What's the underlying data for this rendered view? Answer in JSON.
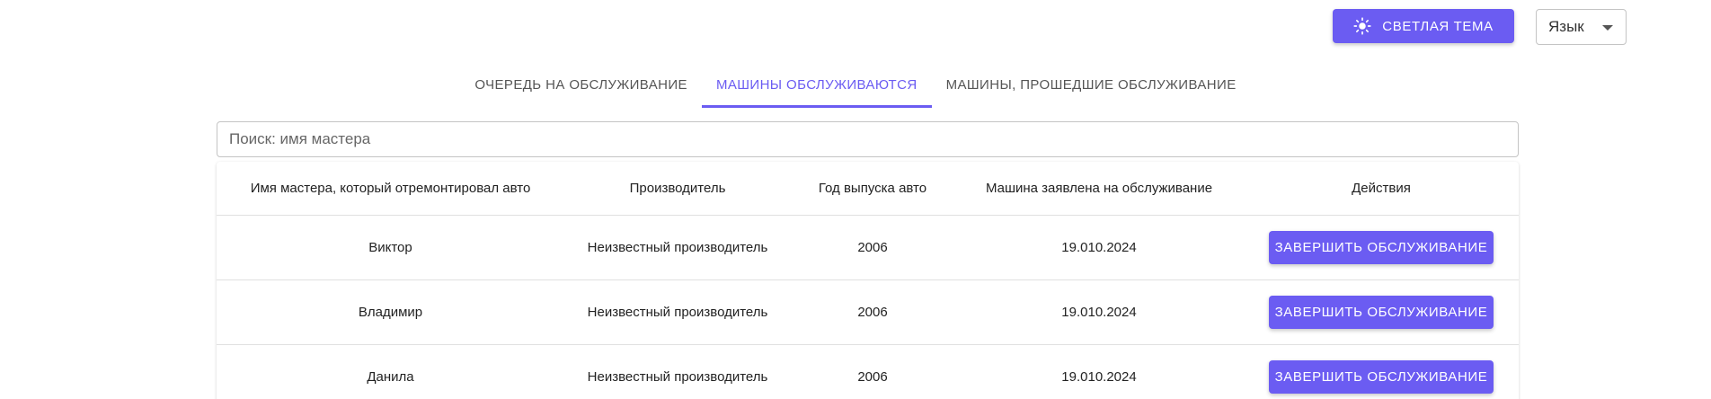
{
  "header": {
    "theme_button_label": "Светлая тема",
    "theme_icon": "sun-icon",
    "language_select": {
      "value": "Язык"
    }
  },
  "tabs": [
    {
      "label": "Очередь на обслуживание",
      "active": false
    },
    {
      "label": "Машины обслуживаются",
      "active": true
    },
    {
      "label": "Машины, прошедшие обслуживание",
      "active": false
    }
  ],
  "search": {
    "placeholder": "Поиск: имя мастера",
    "value": ""
  },
  "table": {
    "headers": {
      "master": "Имя мастера, который отремонтировал авто",
      "manufacturer": "Производитель",
      "year": "Год выпуска авто",
      "date": "Машина заявлена на обслуживание",
      "actions": "Действия"
    },
    "rows": [
      {
        "master": "Виктор",
        "manufacturer": "Неизвестный производитель",
        "year": "2006",
        "date": "19.010.2024",
        "action": "Завершить обслуживание"
      },
      {
        "master": "Владимир",
        "manufacturer": "Неизвестный производитель",
        "year": "2006",
        "date": "19.010.2024",
        "action": "Завершить обслуживание"
      },
      {
        "master": "Данила",
        "manufacturer": "Неизвестный производитель",
        "year": "2006",
        "date": "19.010.2024",
        "action": "Завершить обслуживание"
      }
    ]
  },
  "colors": {
    "accent": "#6b5cf2",
    "border": "#c4c4c4",
    "divider": "#e0e0e0"
  }
}
